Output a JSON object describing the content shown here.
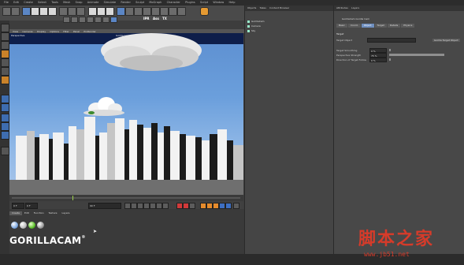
{
  "menubar": {
    "items": [
      "File",
      "Edit",
      "Create",
      "Select",
      "Tools",
      "Mesh",
      "Snap",
      "Animate",
      "Simulate",
      "Render",
      "Sculpt",
      "MoGraph",
      "Character",
      "Plugins",
      "Script",
      "Window",
      "Help"
    ]
  },
  "toolbar": {
    "render_icon_labels": [
      "IPR",
      "Ass",
      "TX"
    ]
  },
  "viewport": {
    "menu": [
      "View",
      "Cameras",
      "Display",
      "Options",
      "Filter",
      "Panel",
      "ProRender"
    ],
    "label": "Perspective",
    "title": "Gorilla Cam 2",
    "sky_color": "#6b9fdc",
    "band_color": "#0e1e4a"
  },
  "transport": {
    "frame_start": "0 F",
    "frame_end": "90 F",
    "frame_current": "0 F"
  },
  "material_panel": {
    "tabs": [
      "Create",
      "Edit",
      "Function",
      "Texture",
      "Layers"
    ],
    "menu": [
      "Create",
      "Edit",
      "Function",
      "Texture"
    ]
  },
  "brand": {
    "text": "GORILLACAM",
    "registered": "®"
  },
  "object_manager": {
    "tabs": [
      "Objects",
      "Takes",
      "Content Browser"
    ],
    "menu": [
      "File",
      "Edit",
      "View",
      "Objects",
      "Tags"
    ],
    "items": [
      "GorillaCam",
      "Camera",
      "Sky"
    ]
  },
  "attributes": {
    "header": [
      "Attributes",
      "Layers"
    ],
    "object_name": "GorillaCam Gorilla Cam",
    "tabs": [
      "Basic",
      "Coord.",
      "Object",
      "Target",
      "Details",
      "Physics"
    ],
    "active_tab": "Object",
    "section_label": "Target",
    "rows": [
      {
        "label": "Target Object",
        "value": "Gorilla Target Object"
      },
      {
        "label": "Target Smoothing",
        "value": "0 %"
      },
      {
        "label": "Perspective Strength",
        "value": "75 %"
      },
      {
        "label": "Direction of Target Follow",
        "value": "0 %"
      }
    ]
  },
  "watermark": {
    "title": "脚本之家",
    "url": "www.jb51.net"
  }
}
